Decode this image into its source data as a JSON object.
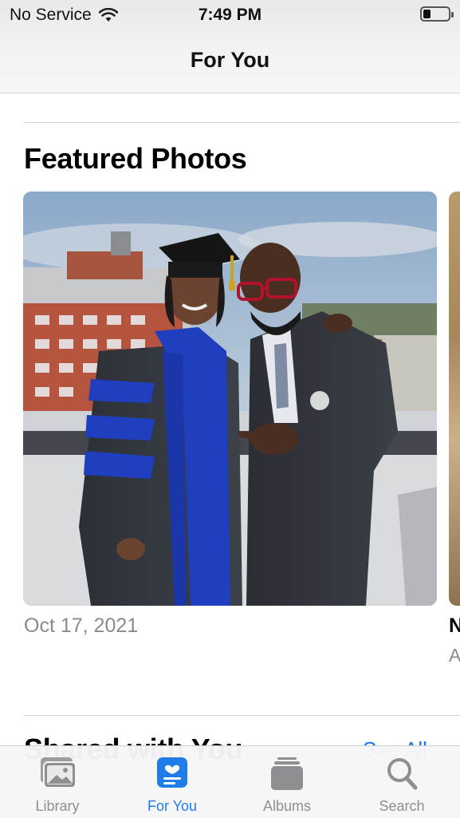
{
  "status_bar": {
    "carrier": "No Service",
    "time": "7:49 PM",
    "battery_level": 0.3
  },
  "nav": {
    "title": "For You"
  },
  "featured": {
    "title": "Featured Photos",
    "cards": [
      {
        "date": "Oct 17, 2021"
      },
      {
        "title": "N",
        "subtitle": "A"
      }
    ]
  },
  "shared": {
    "title": "Shared with You",
    "see_all": "See All"
  },
  "tabbar": {
    "tabs": [
      {
        "label": "Library",
        "icon": "photo-library-icon",
        "active": false
      },
      {
        "label": "For You",
        "icon": "for-you-icon",
        "active": true
      },
      {
        "label": "Albums",
        "icon": "albums-stack-icon",
        "active": false
      },
      {
        "label": "Search",
        "icon": "magnifier-icon",
        "active": false
      }
    ]
  },
  "colors": {
    "accent": "#1f7ce9",
    "inactive": "#8e8e93",
    "secondary_text": "#8a8a8e"
  }
}
